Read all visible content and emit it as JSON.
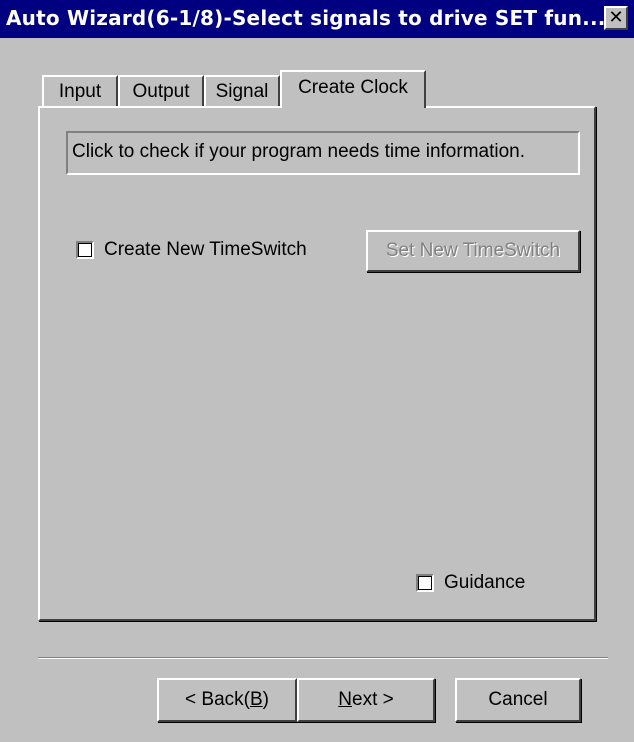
{
  "window": {
    "title": "Auto Wizard(6-1/8)-Select signals to drive SET fun...",
    "close_glyph": "✕"
  },
  "tabs": [
    {
      "label": "Input",
      "active": false
    },
    {
      "label": "Output",
      "active": false
    },
    {
      "label": "Signal",
      "active": false
    },
    {
      "label": "Create Clock",
      "active": true
    }
  ],
  "panel": {
    "info_text": "Click to check if your program needs time information.",
    "create_timeswitch": {
      "label": "Create New TimeSwitch",
      "checked": false
    },
    "set_timeswitch_button": {
      "label": "Set New TimeSwitch",
      "enabled": false
    },
    "guidance": {
      "label": "Guidance",
      "checked": false
    }
  },
  "footer": {
    "back": {
      "prefix": "< Back(",
      "mnemonic": "B",
      "suffix": ")"
    },
    "next": {
      "mnemonic": "N",
      "rest": "ext >"
    },
    "cancel": "Cancel"
  }
}
